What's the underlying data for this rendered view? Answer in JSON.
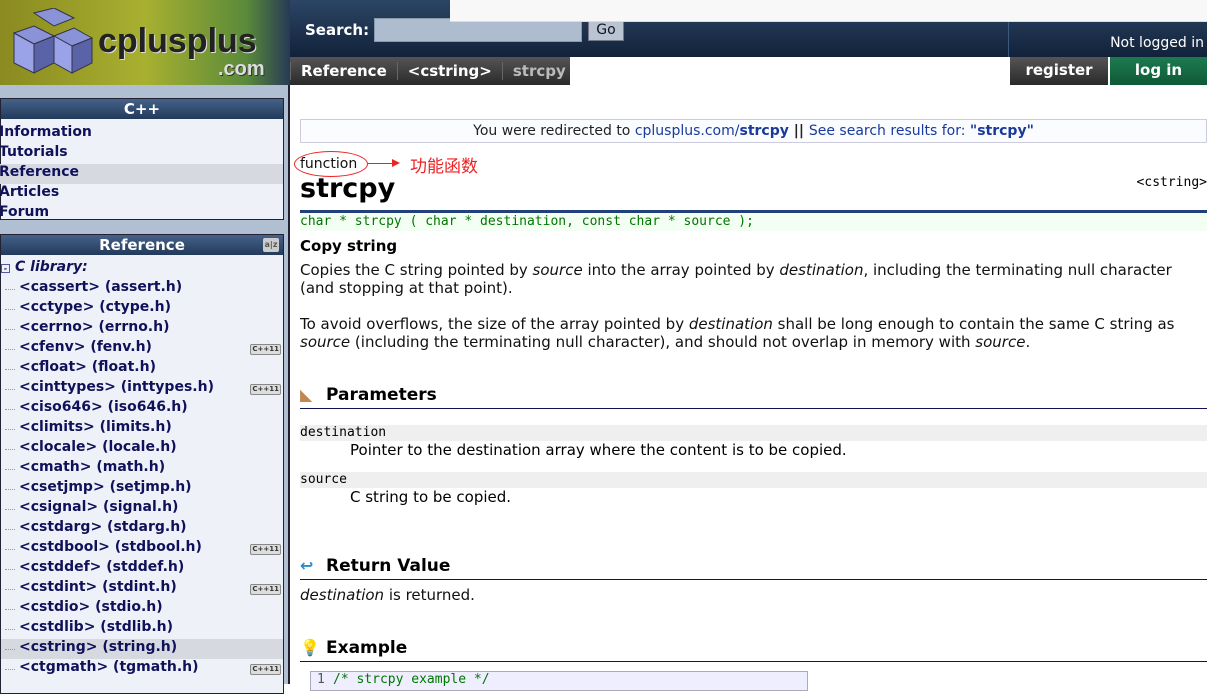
{
  "logo": {
    "text": "cplusplus",
    ".com": ".com",
    "domain": ".com"
  },
  "search": {
    "label": "Search:",
    "value": "",
    "go": "Go"
  },
  "user": {
    "status": "Not logged in",
    "register": "register",
    "login": "log in"
  },
  "breadcrumb": [
    "Reference",
    "<cstring>",
    "strcpy"
  ],
  "sidebar": {
    "cpp_title": "C++",
    "nav": [
      "Information",
      "Tutorials",
      "Reference",
      "Articles",
      "Forum"
    ],
    "ref_title": "Reference",
    "c_library": "C library:",
    "items": [
      {
        "label": "<cassert> (assert.h)",
        "badge": ""
      },
      {
        "label": "<cctype> (ctype.h)",
        "badge": ""
      },
      {
        "label": "<cerrno> (errno.h)",
        "badge": ""
      },
      {
        "label": "<cfenv> (fenv.h)",
        "badge": "C++11"
      },
      {
        "label": "<cfloat> (float.h)",
        "badge": ""
      },
      {
        "label": "<cinttypes> (inttypes.h)",
        "badge": "C++11"
      },
      {
        "label": "<ciso646> (iso646.h)",
        "badge": ""
      },
      {
        "label": "<climits> (limits.h)",
        "badge": ""
      },
      {
        "label": "<clocale> (locale.h)",
        "badge": ""
      },
      {
        "label": "<cmath> (math.h)",
        "badge": ""
      },
      {
        "label": "<csetjmp> (setjmp.h)",
        "badge": ""
      },
      {
        "label": "<csignal> (signal.h)",
        "badge": ""
      },
      {
        "label": "<cstdarg> (stdarg.h)",
        "badge": ""
      },
      {
        "label": "<cstdbool> (stdbool.h)",
        "badge": "C++11"
      },
      {
        "label": "<cstddef> (stddef.h)",
        "badge": ""
      },
      {
        "label": "<cstdint> (stdint.h)",
        "badge": "C++11"
      },
      {
        "label": "<cstdio> (stdio.h)",
        "badge": ""
      },
      {
        "label": "<cstdlib> (stdlib.h)",
        "badge": ""
      },
      {
        "label": "<cstring> (string.h)",
        "badge": ""
      },
      {
        "label": "<ctgmath> (tgmath.h)",
        "badge": "C++11"
      }
    ]
  },
  "main": {
    "redirect_pre": "You were redirected to ",
    "redirect_link_a": "cplusplus.com/",
    "redirect_link_b": "strcpy",
    "redirect_sep": " || ",
    "redirect_search": "See search results for: ",
    "redirect_query": "\"strcpy\"",
    "kind": "function",
    "annotation": "功能函数",
    "title": "strcpy",
    "header": "<cstring>",
    "prototype": "char * strcpy ( char * destination, const char * source );",
    "brief": "Copy string",
    "desc1_a": "Copies the C string pointed by ",
    "desc1_b": "source",
    "desc1_c": " into the array pointed by ",
    "desc1_d": "destination",
    "desc1_e": ", including the terminating null character (and stopping at that point).",
    "desc2_a": "To avoid overflows, the size of the array pointed by ",
    "desc2_b": "destination",
    "desc2_c": " shall be long enough to contain the same C string as ",
    "desc2_d": "source",
    "desc2_e": " (including the terminating null character), and should not overlap in memory with ",
    "desc2_f": "source",
    "desc2_g": ".",
    "params_title": "Parameters",
    "params": [
      {
        "name": "destination",
        "desc": "Pointer to the destination array where the content is to be copied."
      },
      {
        "name": "source",
        "desc": "C string to be copied."
      }
    ],
    "return_title": "Return Value",
    "return_a": "destination",
    "return_b": " is returned.",
    "example_title": "Example",
    "code_line_no": "1",
    "code_line": "/* strcpy example */"
  }
}
